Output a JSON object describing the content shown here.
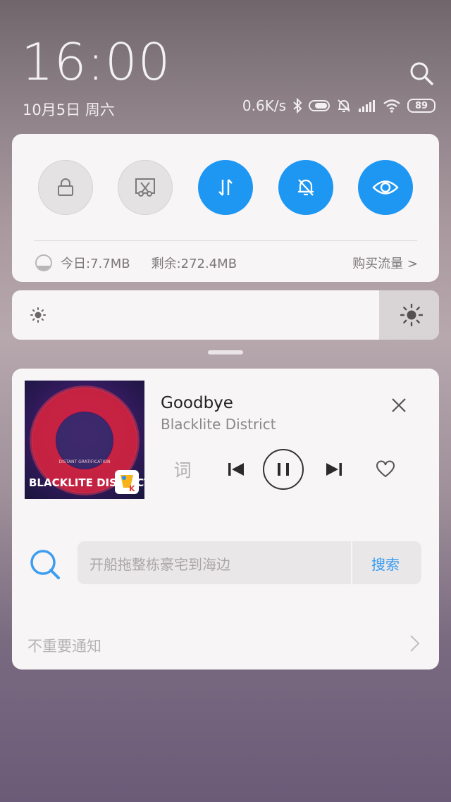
{
  "status": {
    "time": "16:00",
    "date": "10月5日 周六",
    "speed": "0.6K/s",
    "battery": "89"
  },
  "quick_toggles": [
    {
      "name": "lock-screen",
      "icon": "lock-icon",
      "state": "off"
    },
    {
      "name": "screenshot",
      "icon": "screenshot-icon",
      "state": "off"
    },
    {
      "name": "mobile-data",
      "icon": "data-arrows-icon",
      "state": "on"
    },
    {
      "name": "silent",
      "icon": "bell-off-icon",
      "state": "on"
    },
    {
      "name": "reading-mode",
      "icon": "eye-icon",
      "state": "on"
    }
  ],
  "data_usage": {
    "today": "今日:7.7MB",
    "remaining": "剩余:272.4MB",
    "buy": "购买流量 >"
  },
  "brightness": {
    "level_percent": 86
  },
  "music": {
    "title": "Goodbye",
    "artist": "Blacklite District",
    "lyric_label": "词",
    "album_text": "BLACKLITE DISTRICT",
    "album_subtext": "DISTANT GRATIFICATION"
  },
  "search": {
    "placeholder": "开船拖整栋豪宅到海边",
    "button": "搜索"
  },
  "footer": {
    "unimportant_label": "不重要通知"
  },
  "colors": {
    "accent": "#1e97f3",
    "search_link": "#3b9cf0"
  }
}
